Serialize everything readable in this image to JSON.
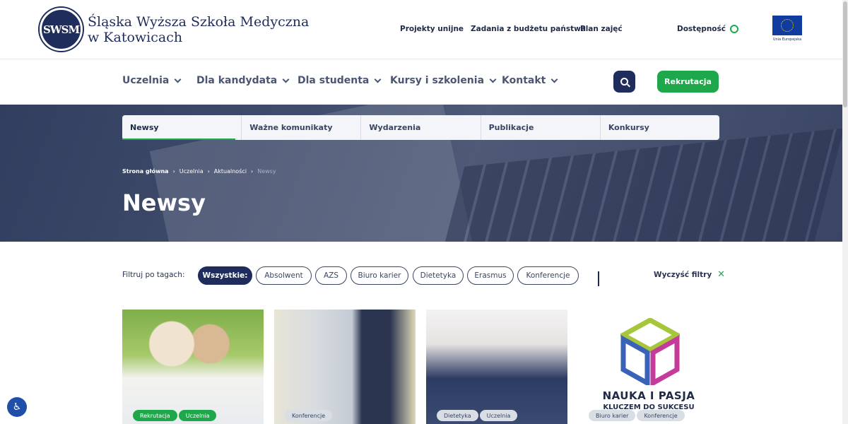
{
  "header": {
    "logo_text": "SWSM",
    "school_name_line1": "Śląska Wyższa Szkoła Medyczna",
    "school_name_line2": "w Katowicach",
    "links": [
      "Projekty unijne",
      "Zadania z budżetu państwa",
      "Plan zajęć"
    ],
    "accessibility": "Dostępność",
    "eu_label": "Unia Europejska"
  },
  "nav": {
    "items": [
      "Uczelnia",
      "Dla kandydata",
      "Dla studenta",
      "Kursy i szkolenia",
      "Kontakt"
    ],
    "recruit_label": "Rekrutacja"
  },
  "hero": {
    "tabs": [
      "Newsy",
      "Ważne komunikaty",
      "Wydarzenia",
      "Publikacje",
      "Konkursy"
    ],
    "active_tab": "Newsy",
    "breadcrumb": [
      "Strona główna",
      "Uczelnia",
      "Aktualności",
      "Newsy"
    ],
    "title": "Newsy"
  },
  "filters": {
    "label": "Filtruj po tagach:",
    "tags": [
      "Wszystkie:",
      "Absolwent",
      "AZS",
      "Biuro karier",
      "Dietetyka",
      "Erasmus",
      "Konferencje"
    ],
    "active": "Wszystkie:",
    "clear_label": "Wyczyść filtry"
  },
  "cards": [
    {
      "tags": [
        "Rekrutacja",
        "Uczelnia"
      ]
    },
    {
      "tags": [
        "Konferencje"
      ]
    },
    {
      "tags": [
        "Dietetyka",
        "Uczelnia"
      ]
    },
    {
      "tags": [
        "Biuro karier",
        "Konferencje"
      ],
      "image_text_line1": "NAUKA I PASJA",
      "image_text_line2": "KLUCZEM DO SUKCESU"
    }
  ],
  "colors": {
    "brand_navy": "#1f2d5c",
    "accent_green": "#1fa84b"
  }
}
